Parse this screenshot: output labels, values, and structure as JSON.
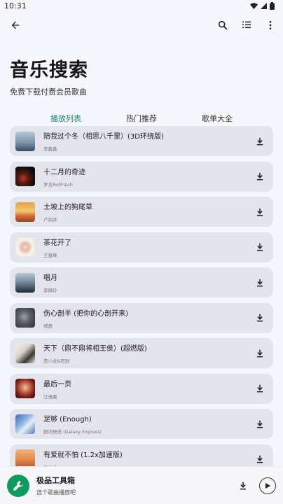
{
  "status_bar": {
    "time": "10:31"
  },
  "icons": {
    "back": "arrow-back-icon",
    "search": "search-icon",
    "queue": "playlist-icon",
    "more": "more-vert-icon"
  },
  "hero": {
    "title": "音乐搜索",
    "subtitle": "免费下载付费会员歌曲"
  },
  "tabs": [
    {
      "label": "播放列表",
      "active": true
    },
    {
      "label": "热门推荐",
      "active": false
    },
    {
      "label": "歌单大全",
      "active": false
    }
  ],
  "songs": [
    {
      "title": "陪我过个冬（相思八千里）(3D环绕版)",
      "artist": "李鑫鑫"
    },
    {
      "title": "十二月的奇迹",
      "artist": "罗言RollFlash"
    },
    {
      "title": "土坡上的狗尾草",
      "artist": "卢润泽"
    },
    {
      "title": "茶花开了",
      "artist": "王晋章"
    },
    {
      "title": "唱月",
      "artist": "李佩玲"
    },
    {
      "title": "伤心剖半 (把你的心剖开来)",
      "artist": "郑茜"
    },
    {
      "title": "天下（鼎不鼎将相王侯）(超燃版)",
      "artist": "贵小龙&旺财"
    },
    {
      "title": "最后一页",
      "artist": "江语晨"
    },
    {
      "title": "足够 (Enough)",
      "artist": "银河快递 (Galaxy Express)"
    },
    {
      "title": "有爱就不怕 (1.2x加速版)",
      "artist": "王心凌"
    }
  ],
  "player": {
    "title": "极品工具箱",
    "subtitle": "选个歌曲播放吧"
  },
  "colors": {
    "accent": "#1a8a6a",
    "logo": "#0f9a5f",
    "card": "#e3e4ec"
  }
}
